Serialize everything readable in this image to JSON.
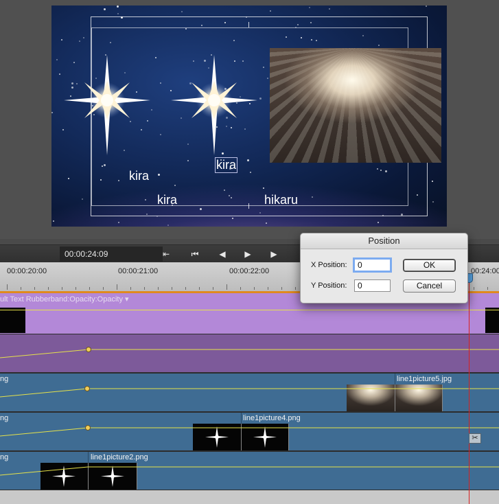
{
  "preview": {
    "texts": [
      "kira",
      "kira",
      "kira",
      "hikaru"
    ]
  },
  "transport": {
    "timecode": "00:00:24:09",
    "buttons": [
      {
        "name": "go-to-start-icon",
        "glyph": "⇤"
      },
      {
        "name": "previous-edit-icon",
        "glyph": "⏮"
      },
      {
        "name": "step-back-icon",
        "glyph": "◀"
      },
      {
        "name": "play-icon",
        "glyph": "▶"
      },
      {
        "name": "step-forward-icon",
        "glyph": "▶"
      }
    ]
  },
  "ruler": {
    "labels": [
      "00:00:20:00",
      "00:00:21:00",
      "00:00:22:00",
      "00:24:00"
    ]
  },
  "tracks": {
    "title_track_label": "ult Text Rubberband:Opacity:Opacity ▾",
    "track3_partial": "ng",
    "track3_clip": "line1picture5.jpg",
    "track4_partial": "ng",
    "track4_clip": "line1picture4.png",
    "track5_partial": "ng",
    "track5_clip": "line1picture2.png"
  },
  "dialog": {
    "title": "Position",
    "x_label": "X Position:",
    "x_value": "0",
    "y_label": "Y Position:",
    "y_value": "0",
    "ok_label": "OK",
    "cancel_label": "Cancel"
  },
  "colors": {
    "playhead": "#d82020",
    "title_track": "#b388d8",
    "video_track": "#3f6c93",
    "rubberband": "#e6e24a"
  }
}
